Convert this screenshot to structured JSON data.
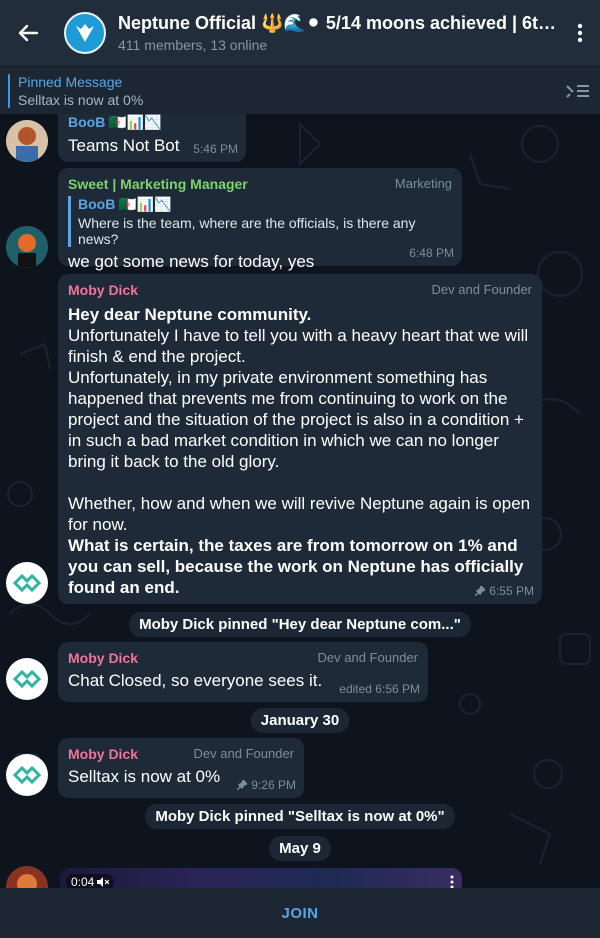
{
  "header": {
    "title": "Neptune Official 🔱🌊⚫ 5/14 moons achieved | 6th...",
    "subtitle": "411 members, 13 online"
  },
  "pinned": {
    "title": "Pinned Message",
    "text": "Selltax is now at 0%"
  },
  "messages": [
    {
      "sender": "BooB 🇩🇿📊📉",
      "text": "Teams Not Bot",
      "time": "5:46 PM"
    },
    {
      "sender": "Sweet | Marketing Manager",
      "role": "Marketing",
      "reply_name": "BooB 🇩🇿📊📉",
      "reply_text": "Where is the team, where are the officials, is there any news?",
      "text": "we got some news for today, yes",
      "time": "6:48 PM"
    },
    {
      "sender": "Moby Dick",
      "role": "Dev and Founder",
      "heading": "Hey dear Neptune community.",
      "body": "Unfortunately I have to tell you with a heavy heart that we will finish & end the project.\nUnfortunately, in my private environment something has happened that prevents me from continuing to work on the project and the situation of the project is also in a condition + in such a bad market condition in which we can no longer bring it back to the old glory.\n\nWhether, how and when we will revive Neptune again is open for now.",
      "closing": "What is certain, the taxes are from tomorrow on 1% and you can sell, because the work on Neptune has officially found an end.",
      "time": "6:55 PM"
    },
    {
      "sender": "Moby Dick",
      "role": "Dev and Founder",
      "text": "Chat Closed, so everyone sees it.",
      "time": "edited 6:56 PM"
    },
    {
      "sender": "Moby Dick",
      "role": "Dev and Founder",
      "text": "Selltax is now at 0%",
      "time": "9:26 PM"
    }
  ],
  "service": {
    "pin1": "Moby Dick pinned \"Hey dear Neptune com...\"",
    "date1": "January 30",
    "pin2": "Moby Dick pinned \"Selltax is now at 0%\"",
    "date2": "May 9"
  },
  "video": {
    "duration": "0:04"
  },
  "join_label": "JOIN",
  "colors": {
    "sender_pink": "#f0739a",
    "sender_green": "#7fd36b",
    "sender_blue": "#5aa6e5",
    "accent": "#5aa6e5"
  }
}
